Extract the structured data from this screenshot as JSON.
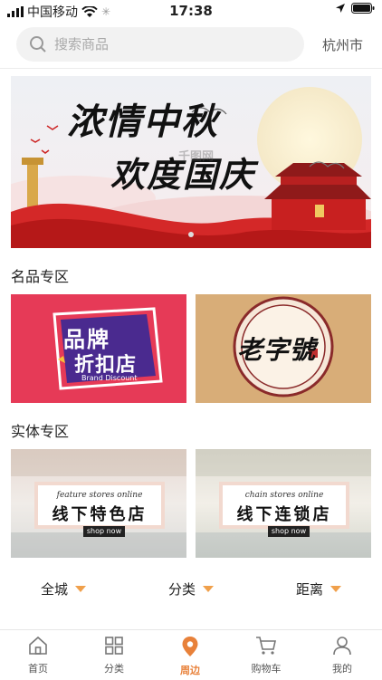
{
  "status_bar": {
    "carrier": "中国移动",
    "time": "17:38"
  },
  "search": {
    "placeholder": "搜索商品"
  },
  "city": "杭州市",
  "banner": {
    "line1": "浓情中秋",
    "line2": "欢度国庆",
    "watermark": "千图网"
  },
  "sections": {
    "brand": "名品专区",
    "physical": "实体专区"
  },
  "cards": {
    "brand": {
      "title_top": "品牌",
      "title_bottom": "折扣店",
      "subtitle": "Brand Discount"
    },
    "old": {
      "title": "老字號"
    },
    "feature": {
      "small": "feature  stores  online",
      "big": "线下特色店",
      "button": "shop now"
    },
    "chain": {
      "small": "chain  stores  online",
      "big": "线下连锁店",
      "button": "shop now"
    }
  },
  "filters": [
    "全城",
    "分类",
    "距离"
  ],
  "tabs": [
    {
      "label": "首页",
      "icon": "home-icon"
    },
    {
      "label": "分类",
      "icon": "grid-icon"
    },
    {
      "label": "周边",
      "icon": "location-pin-icon",
      "active": true
    },
    {
      "label": "购物车",
      "icon": "cart-icon"
    },
    {
      "label": "我的",
      "icon": "user-icon"
    }
  ],
  "colors": {
    "accent": "#e8813a",
    "filter_arrow": "#f0a04b",
    "brand_card": "#e63a57",
    "old_card": "#d8ad78"
  }
}
